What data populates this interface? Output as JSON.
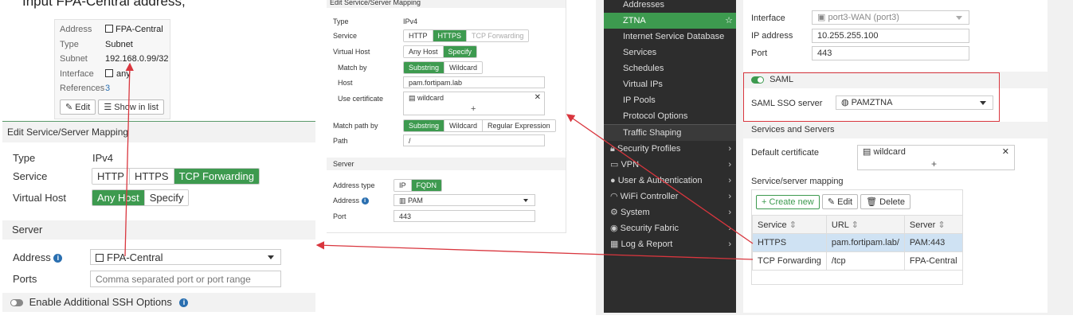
{
  "colors": {
    "accent": "#3d9a4f",
    "sidebar": "#2d2d2d",
    "sidebar_active": "#3d9a4f",
    "arrow": "#d9363e",
    "info": "#2a6fb0"
  },
  "caption": "Input FPA-Central address,",
  "address_tooltip": {
    "rows": [
      {
        "label": "Address",
        "value": "FPA-Central"
      },
      {
        "label": "Type",
        "value": "Subnet"
      },
      {
        "label": "Subnet",
        "value": "192.168.0.99/32"
      },
      {
        "label": "Interface",
        "value": "any"
      },
      {
        "label": "References",
        "value": "3"
      }
    ],
    "edit": "Edit",
    "show_in_list": "Show in list"
  },
  "tcp_mapping": {
    "title": "Edit Service/Server Mapping",
    "type_label": "Type",
    "type_value": "IPv4",
    "service_label": "Service",
    "services": [
      "HTTP",
      "HTTPS",
      "TCP Forwarding"
    ],
    "vhost_label": "Virtual Host",
    "vhosts": [
      "Any Host",
      "Specify"
    ],
    "server_section": "Server",
    "address_label": "Address",
    "address_value": "FPA-Central",
    "ports_label": "Ports",
    "ports_placeholder": "Comma separated port or port range",
    "ssh_label": "Enable Additional SSH Options"
  },
  "https_mapping": {
    "title": "Edit Service/Server Mapping",
    "type_label": "Type",
    "type_value": "IPv4",
    "service_label": "Service",
    "services": [
      "HTTP",
      "HTTPS",
      "TCP Forwarding"
    ],
    "vhost_label": "Virtual Host",
    "vhosts": [
      "Any Host",
      "Specify"
    ],
    "match_label": "Match by",
    "match": [
      "Substring",
      "Wildcard"
    ],
    "host_label": "Host",
    "host_value": "pam.fortipam.lab",
    "cert_label": "Use certificate",
    "cert_value": "wildcard",
    "path_match_label": "Match path by",
    "path_match": [
      "Substring",
      "Wildcard",
      "Regular Expression"
    ],
    "path_label": "Path",
    "path_value": "/",
    "server_section": "Server",
    "addr_type_label": "Address type",
    "addr_types": [
      "IP",
      "FQDN"
    ],
    "address_label": "Address",
    "address_value": "PAM",
    "port_label": "Port",
    "port_value": "443"
  },
  "sidebar": {
    "items": [
      {
        "label": "Addresses",
        "level": "sub"
      },
      {
        "label": "ZTNA",
        "level": "sub",
        "active": true
      },
      {
        "label": "Internet Service Database",
        "level": "sub"
      },
      {
        "label": "Services",
        "level": "sub"
      },
      {
        "label": "Schedules",
        "level": "sub"
      },
      {
        "label": "Virtual IPs",
        "level": "sub"
      },
      {
        "label": "IP Pools",
        "level": "sub"
      },
      {
        "label": "Protocol Options",
        "level": "sub"
      },
      {
        "label": "Traffic Shaping",
        "level": "sub"
      },
      {
        "label": "Security Profiles",
        "level": "top"
      },
      {
        "label": "VPN",
        "level": "top"
      },
      {
        "label": "User & Authentication",
        "level": "top"
      },
      {
        "label": "WiFi Controller",
        "level": "top"
      },
      {
        "label": "System",
        "level": "top"
      },
      {
        "label": "Security Fabric",
        "level": "top"
      },
      {
        "label": "Log & Report",
        "level": "top"
      }
    ]
  },
  "ztna": {
    "interface_label": "Interface",
    "interface_value": "port3-WAN (port3)",
    "ip_label": "IP address",
    "ip_value": "10.255.255.100",
    "port_label": "Port",
    "port_value": "443",
    "saml_label": "SAML",
    "saml_server_label": "SAML SSO server",
    "saml_server_value": "PAMZTNA",
    "services_section": "Services and Servers",
    "default_cert_label": "Default certificate",
    "default_cert_value": "wildcard",
    "mapping_label": "Service/server mapping",
    "create_new": "Create new",
    "edit": "Edit",
    "delete": "Delete",
    "columns": [
      "Service",
      "URL",
      "Server"
    ],
    "rows": [
      {
        "service": "HTTPS",
        "url": "pam.fortipam.lab/",
        "server": "PAM:443"
      },
      {
        "service": "TCP Forwarding",
        "url": "/tcp",
        "server": "FPA-Central"
      }
    ]
  }
}
